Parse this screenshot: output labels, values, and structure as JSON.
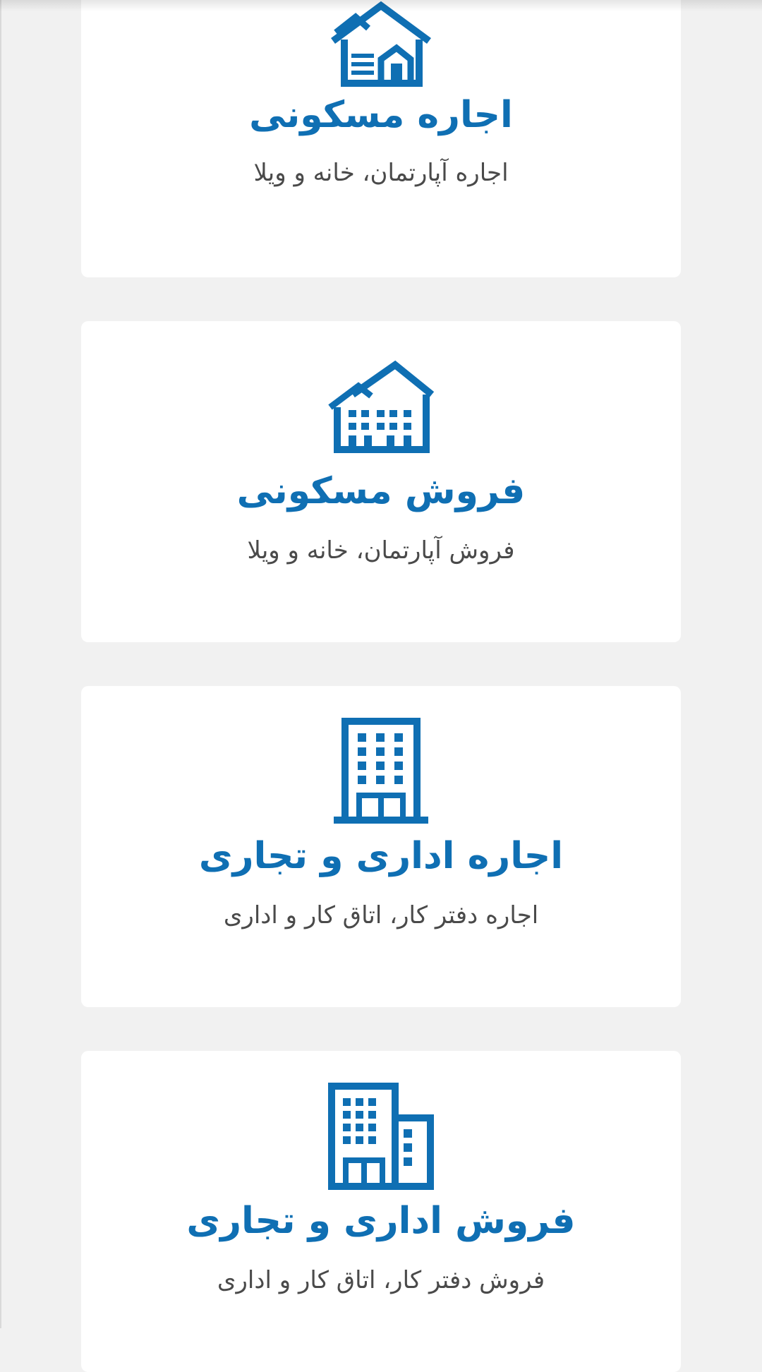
{
  "accent_color": "#0f6fb3",
  "cards": [
    {
      "icon": "house-icon",
      "title": "اجاره مسکونی",
      "subtitle": "اجاره آپارتمان، خانه و ویلا"
    },
    {
      "icon": "residential-buildings-icon",
      "title": "فروش مسکونی",
      "subtitle": "فروش آپارتمان، خانه و ویلا"
    },
    {
      "icon": "office-building-icon",
      "title": "اجاره اداری و تجاری",
      "subtitle": "اجاره دفتر کار، اتاق کار و اداری"
    },
    {
      "icon": "office-buildings-icon",
      "title": "فروش اداری و تجاری",
      "subtitle": "فروش دفتر کار، اتاق کار و اداری"
    }
  ]
}
